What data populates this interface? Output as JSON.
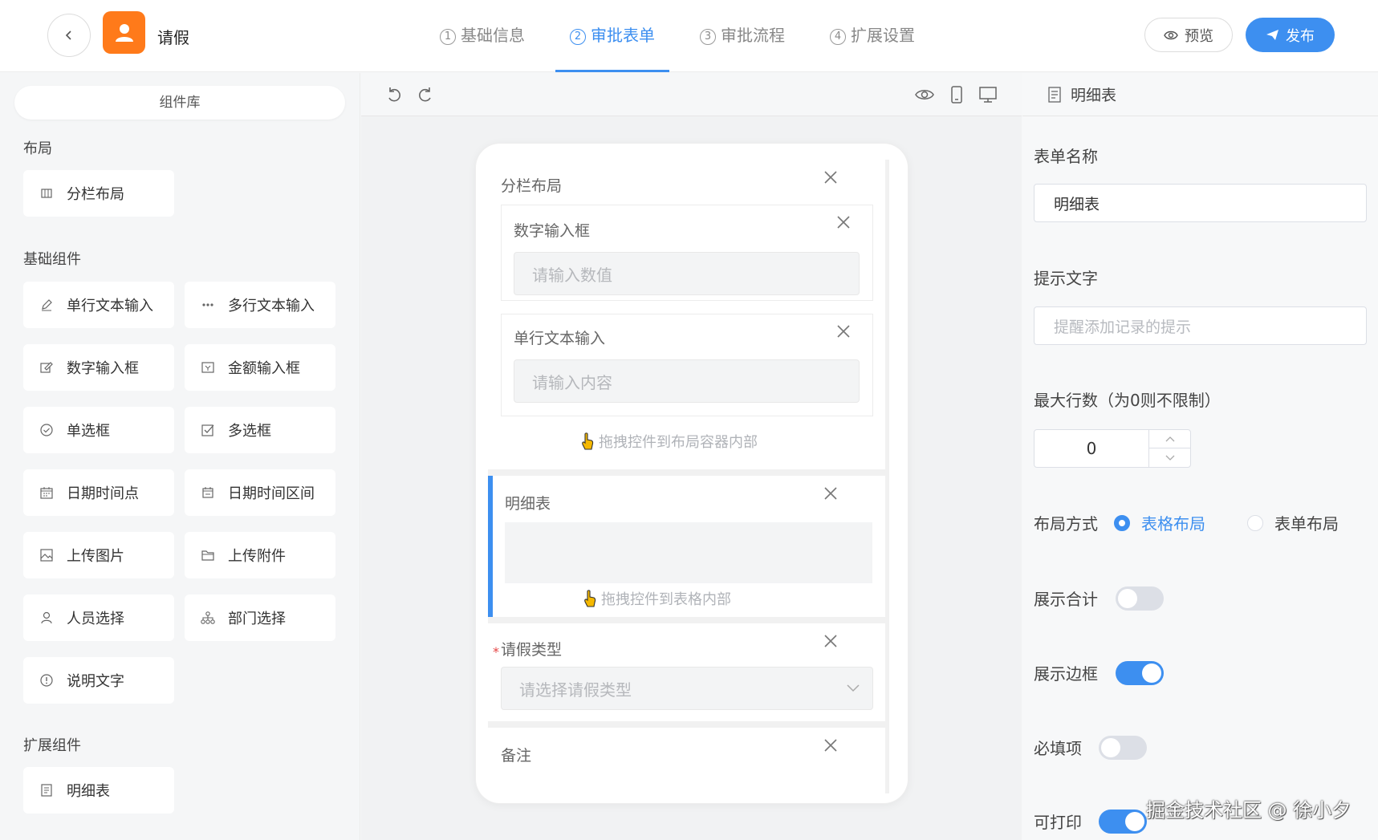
{
  "header": {
    "title": "请假",
    "steps": [
      {
        "num": "1",
        "label": "基础信息"
      },
      {
        "num": "2",
        "label": "审批表单"
      },
      {
        "num": "3",
        "label": "审批流程"
      },
      {
        "num": "4",
        "label": "扩展设置"
      }
    ],
    "active_step": 2,
    "preview_label": "预览",
    "publish_label": "发布"
  },
  "library": {
    "title": "组件库",
    "groups": {
      "layout": {
        "title": "布局",
        "items": [
          "分栏布局"
        ]
      },
      "basic": {
        "title": "基础组件",
        "items": [
          "单行文本输入",
          "多行文本输入",
          "数字输入框",
          "金额输入框",
          "单选框",
          "多选框",
          "日期时间点",
          "日期时间区间",
          "上传图片",
          "上传附件",
          "人员选择",
          "部门选择",
          "说明文字"
        ]
      },
      "ext": {
        "title": "扩展组件",
        "items": [
          "明细表"
        ]
      }
    }
  },
  "canvas": {
    "column_layout": {
      "label": "分栏布局",
      "number_field": {
        "label": "数字输入框",
        "placeholder": "请输入数值"
      },
      "text_field": {
        "label": "单行文本输入",
        "placeholder": "请输入内容"
      },
      "hint": "拖拽控件到布局容器内部"
    },
    "detail_table": {
      "label": "明细表",
      "hint": "拖拽控件到表格内部"
    },
    "leave_type": {
      "required_mark": "*",
      "label": "请假类型",
      "placeholder": "请选择请假类型"
    },
    "remark": {
      "label": "备注"
    }
  },
  "props": {
    "header": "明细表",
    "form_name": {
      "label": "表单名称",
      "value": "明细表"
    },
    "hint_text": {
      "label": "提示文字",
      "placeholder": "提醒添加记录的提示"
    },
    "max_rows": {
      "label": "最大行数（为0则不限制）",
      "value": "0"
    },
    "layout_mode": {
      "label": "布局方式",
      "options": [
        "表格布局",
        "表单布局"
      ],
      "selected": "表格布局"
    },
    "show_total": {
      "label": "展示合计",
      "on": false
    },
    "show_border": {
      "label": "展示边框",
      "on": true
    },
    "required": {
      "label": "必填项",
      "on": false
    },
    "printable": {
      "label": "可打印",
      "on": true
    },
    "accent_color": "#3d8ff0"
  },
  "watermark": "掘金技术社区 @ 徐小夕"
}
